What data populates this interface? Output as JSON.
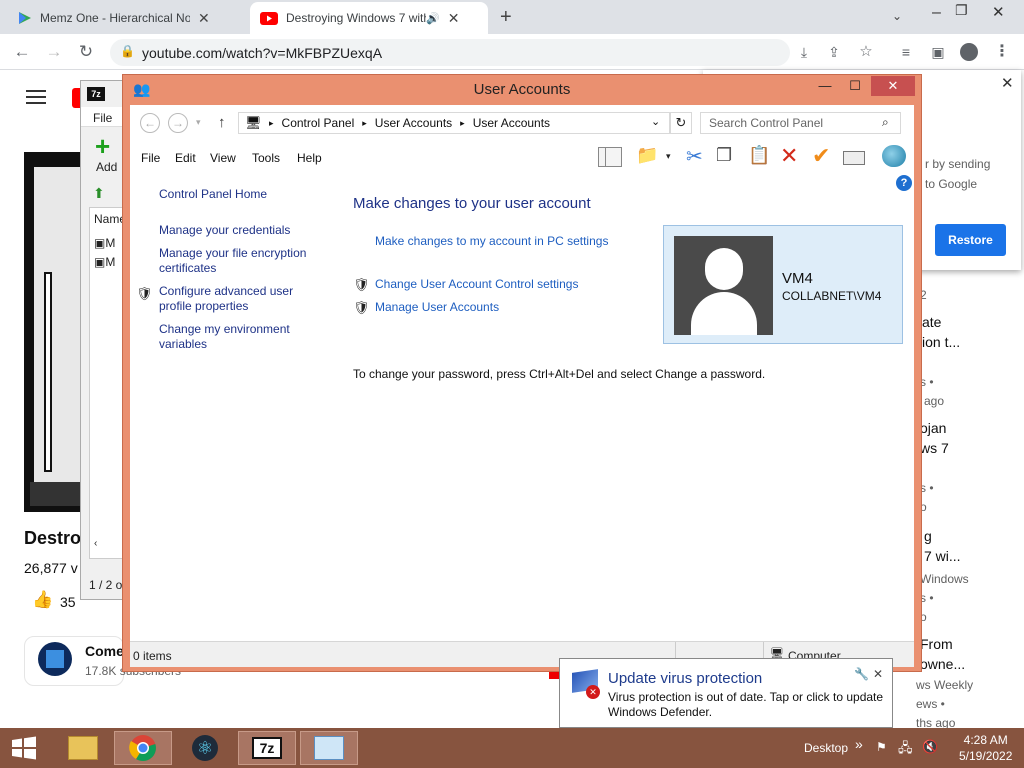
{
  "browser": {
    "tabs": [
      {
        "title": "Memz One - Hierarchical Notepa",
        "close": "✕"
      },
      {
        "title": "Destroying Windows 7 with ",
        "close": "✕"
      }
    ],
    "url": "youtube.com/watch?v=MkFBPZUexqA"
  },
  "youtube": {
    "video_title": "Destro",
    "views": "26,877 v",
    "likes": "35",
    "channel_name": "Come",
    "channel_subs": "17.8K subscribers",
    "popup": {
      "line1": "r by sending",
      "line2": "to Google",
      "restore_label": "Restore"
    },
    "sidebar": [
      {
        "t": "2",
        "kind": "meta"
      },
      {
        "t": "ate",
        "kind": "title"
      },
      {
        "t": "ion t...",
        "kind": "title"
      },
      {
        "t": "s •",
        "kind": "meta"
      },
      {
        "t": "ago",
        "kind": "meta"
      },
      {
        "t": "ojan",
        "kind": "title"
      },
      {
        "t": "ws 7",
        "kind": "title"
      },
      {
        "t": "s •",
        "kind": "meta"
      },
      {
        "t": "o",
        "kind": "meta"
      },
      {
        "t": "g",
        "kind": "title"
      },
      {
        "t": "7 wi...",
        "kind": "title"
      },
      {
        "t": "Windows",
        "kind": "meta"
      },
      {
        "t": "s •",
        "kind": "meta"
      },
      {
        "t": "o",
        "kind": "meta"
      },
      {
        "t": "From",
        "kind": "title"
      },
      {
        "t": "owne...",
        "kind": "title"
      },
      {
        "t": "ws Weekly",
        "kind": "meta"
      },
      {
        "t": "ews •",
        "kind": "meta"
      },
      {
        "t": "ths ago",
        "kind": "meta"
      }
    ]
  },
  "sevenzip": {
    "menu_file": "File",
    "add_label": "Add",
    "name_col": "Name",
    "row1": "M",
    "row2": "M",
    "status": "1 / 2 o"
  },
  "user_accounts": {
    "window_title": "User Accounts",
    "breadcrumb": [
      "Control Panel",
      "User Accounts",
      "User Accounts"
    ],
    "search_placeholder": "Search Control Panel",
    "menu": [
      "File",
      "Edit",
      "View",
      "Tools",
      "Help"
    ],
    "left_nav": {
      "home": "Control Panel Home",
      "credentials": "Manage your credentials",
      "encryption_1": "Manage your file encryption",
      "encryption_2": "certificates",
      "advanced_1": "Configure advanced user",
      "advanced_2": "profile properties",
      "env_1": "Change my environment",
      "env_2": "variables"
    },
    "heading": "Make changes to your user account",
    "pc_settings_link": "Make changes to my account in PC settings",
    "uac_link": "Change User Account Control settings",
    "manage_link": "Manage User Accounts",
    "password_text": "To change your password, press Ctrl+Alt+Del and select Change a password.",
    "account": {
      "name": "VM4",
      "domain": "COLLABNET\\VM4"
    },
    "status_items": "0 items",
    "status_computer": "Computer"
  },
  "notification": {
    "title": "Update virus protection",
    "body_1": "Virus protection is out of date. Tap or click to update",
    "body_2": "Windows Defender."
  },
  "taskbar": {
    "desktop_label": "Desktop",
    "chevron": "»",
    "time": "4:28 AM",
    "date": "5/19/2022",
    "sevenzip_label": "7z"
  },
  "colors": {
    "window_frame": "#ea9070",
    "taskbar": "#87543f",
    "link": "#1e5ec0",
    "close": "#c75050"
  }
}
